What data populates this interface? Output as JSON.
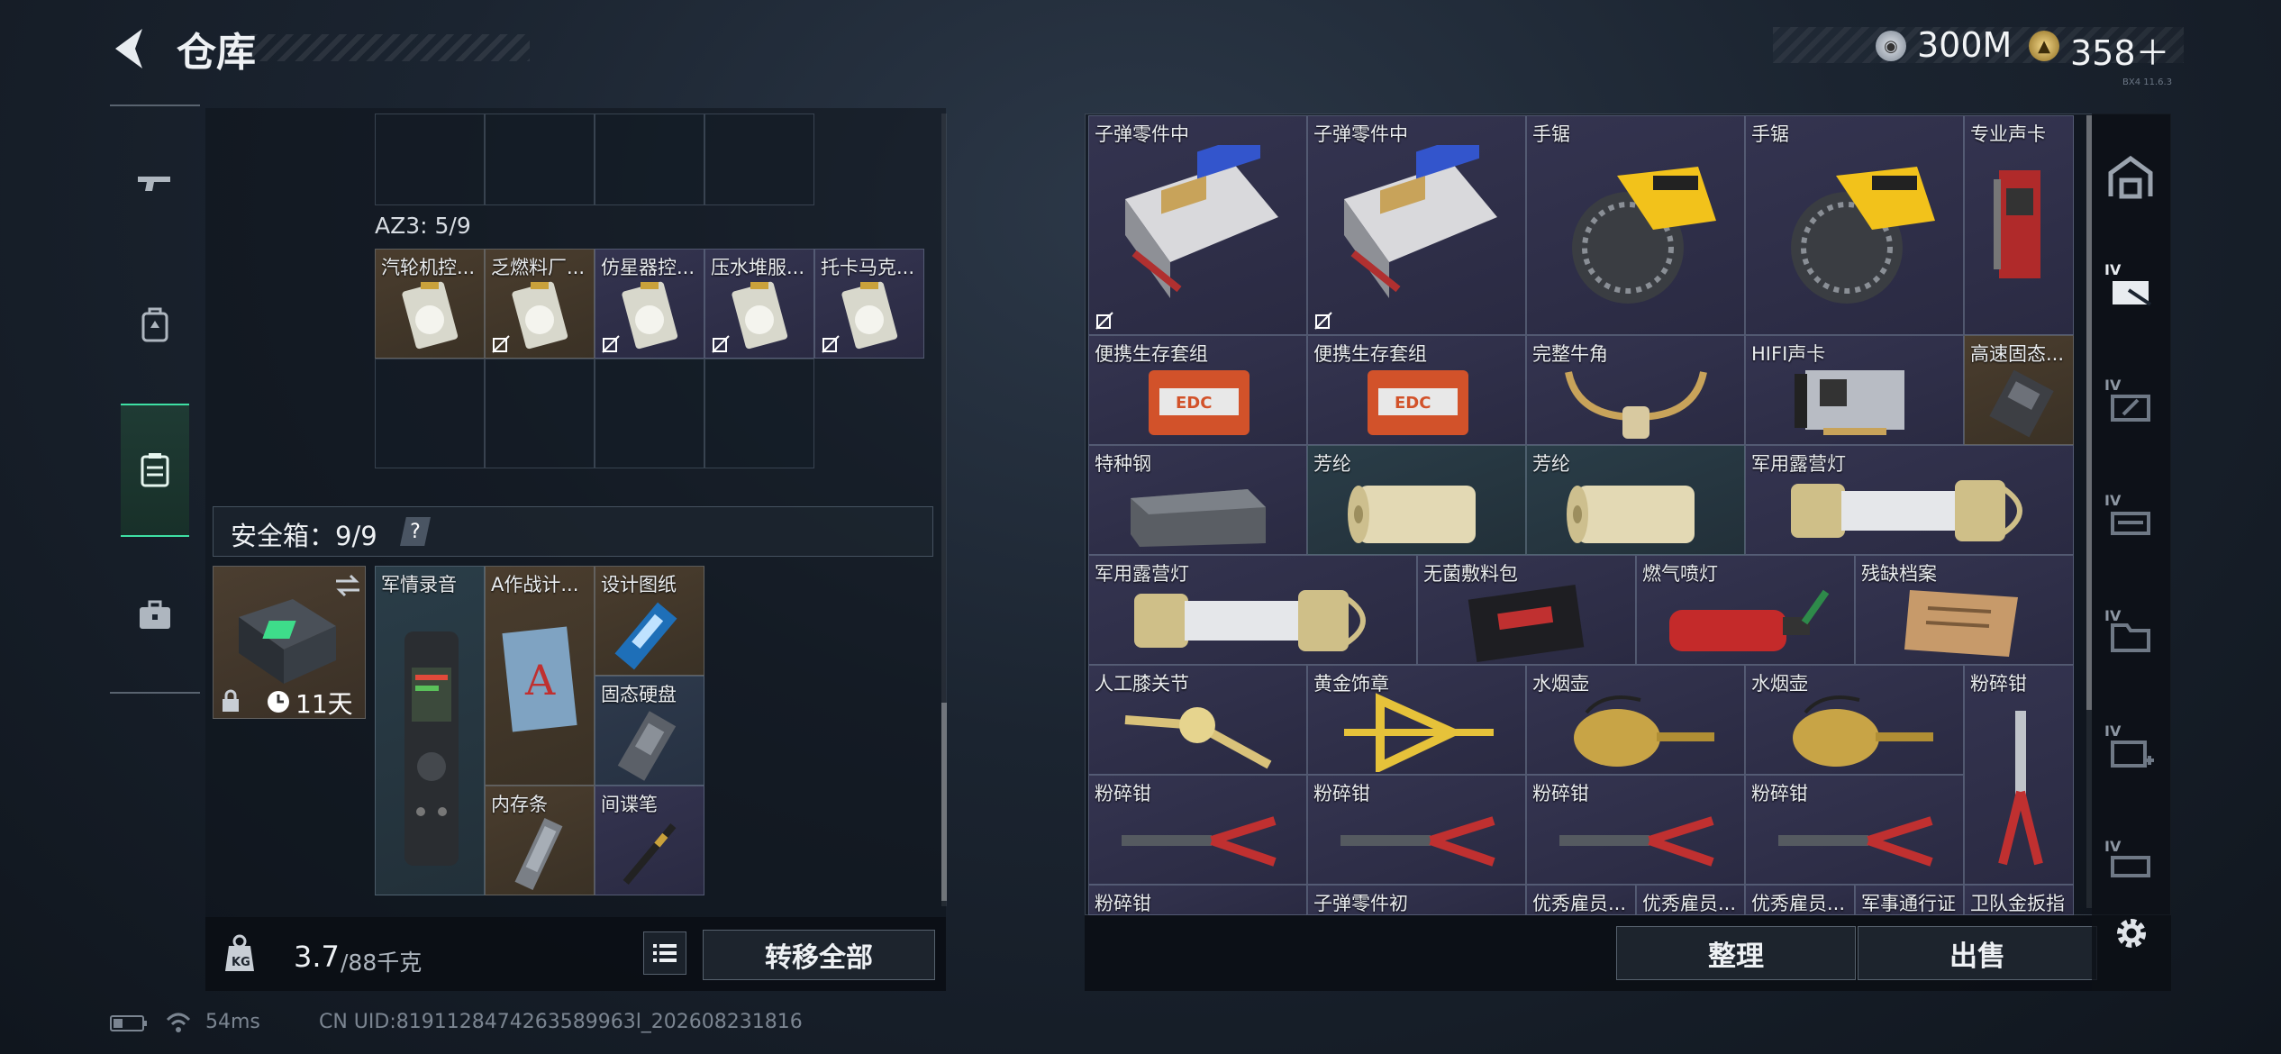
{
  "header": {
    "title": "仓库",
    "silver_amount": "300M",
    "gold_amount": "358＋",
    "version": "BX4 11.6.3"
  },
  "left_rail": [
    "weapon",
    "armor",
    "storage",
    "toolbox"
  ],
  "container": {
    "label": "AZ3: 5/9",
    "items": [
      "汽轮机控...",
      "乏燃料厂...",
      "仿星器控...",
      "压水堆服...",
      "托卡马克..."
    ]
  },
  "safe": {
    "label": "安全箱：9/9",
    "help": "?",
    "days": "11天",
    "items": [
      "军情录音",
      "A作战计...",
      "设计图纸",
      "固态硬盘",
      "内存条",
      "间谍笔"
    ]
  },
  "weight": {
    "current": "3.7",
    "max": "/88千克",
    "transfer_label": "转移全部"
  },
  "inventory": {
    "row1": [
      "子弹零件中",
      "子弹零件中",
      "手锯",
      "手锯",
      "专业声卡"
    ],
    "row2": [
      "便携生存套组",
      "便携生存套组",
      "完整牛角",
      "HIFI声卡",
      "高速固态..."
    ],
    "row3": [
      "特种钢",
      "芳纶",
      "芳纶",
      "军用露营灯"
    ],
    "row4": [
      "军用露营灯",
      "无菌敷料包",
      "燃气喷灯",
      "残缺档案"
    ],
    "row5": [
      "人工膝关节",
      "黄金饰章",
      "水烟壶",
      "水烟壶",
      "粉碎钳"
    ],
    "row6": [
      "粉碎钳",
      "粉碎钳",
      "粉碎钳",
      "粉碎钳"
    ],
    "row7": [
      "粉碎钳",
      "子弹零件初",
      "优秀雇员...",
      "优秀雇员...",
      "优秀雇员...",
      "军事通行证",
      "卫队金扳指"
    ],
    "sort_label": "整理",
    "sell_label": "出售"
  },
  "right_rail": {
    "iv_tag": "IV"
  },
  "status": {
    "ping": "54ms",
    "uid": "CN UID:8191128474263589963l_202608231816"
  }
}
